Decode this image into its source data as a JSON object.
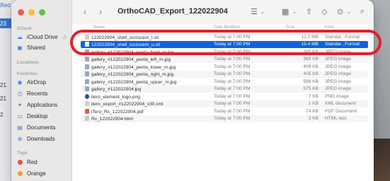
{
  "backdrop": {
    "left_items": [
      "ified",
      "23",
      "21",
      "21",
      "2"
    ]
  },
  "window": {
    "title": "OrthoCAD_Export_122022904",
    "toolbar": {
      "back_icon": "chevron-left",
      "forward_icon": "chevron-right",
      "view_icon": "list-view",
      "group_icon": "grid-view",
      "share_icon": "share",
      "tag_icon": "tag",
      "more_icon": "ellipsis-circle",
      "search_icon": "magnifier"
    },
    "sidebar": {
      "sections": [
        {
          "label": "iCloud",
          "items": [
            {
              "label": "iCloud Drive",
              "icon": "cloud-icon",
              "warning": "⚠"
            },
            {
              "label": "Shared",
              "icon": "shared-folder-icon"
            }
          ]
        },
        {
          "label": "Locations",
          "items": []
        },
        {
          "label": "Favorites",
          "items": [
            {
              "label": "AirDrop",
              "icon": "airdrop-icon"
            },
            {
              "label": "Recents",
              "icon": "clock-icon"
            },
            {
              "label": "Applications",
              "icon": "applications-icon"
            },
            {
              "label": "Desktop",
              "icon": "desktop-icon"
            },
            {
              "label": "Documents",
              "icon": "document-icon"
            },
            {
              "label": "Downloads",
              "icon": "download-icon"
            }
          ]
        },
        {
          "label": "Tags",
          "items": [
            {
              "label": "Red",
              "color": "#ee4b4b"
            },
            {
              "label": "Orange",
              "color": "#f39c34"
            }
          ]
        }
      ]
    },
    "columns": {
      "name": "Name",
      "date": "Date Modified",
      "size": "Size",
      "kind": "Kind"
    },
    "files": [
      {
        "name": "122022904_shell_occlusion_l.stl",
        "date": "Today at 7:00 PM",
        "size": "12.2 MB",
        "kind": "Standar...Format",
        "type": "stl"
      },
      {
        "name": "122022904_shell_occlusion_u.stl",
        "date": "Today at 7:00 PM",
        "size": "15.4 MB",
        "kind": "Standar...Format",
        "type": "stl",
        "selected": true
      },
      {
        "name": "gallery_#122022904_penta_front_m.jpg",
        "date": "Today at 7:00 PM",
        "size": "385 KB",
        "kind": "JPEG image",
        "type": "jpg"
      },
      {
        "name": "gallery_#122022904_penta_left_m.jpg",
        "date": "Today at 7:00 PM",
        "size": "389 KB",
        "kind": "JPEG image",
        "type": "jpg"
      },
      {
        "name": "gallery_#122022904_penta_lower_m.jpg",
        "date": "Today at 7:00 PM",
        "size": "409 KB",
        "kind": "JPEG image",
        "type": "jpg"
      },
      {
        "name": "gallery_#122022904_penta_right_m.jpg",
        "date": "Today at 7:00 PM",
        "size": "405 KB",
        "kind": "JPEG image",
        "type": "jpg"
      },
      {
        "name": "gallery_#122022904_penta_upper_m.jpg",
        "date": "Today at 7:00 PM",
        "size": "596 KB",
        "kind": "JPEG image",
        "type": "jpg"
      },
      {
        "name": "gallery_#122022904.jpg",
        "date": "Today at 7:00 PM",
        "size": "575 KB",
        "kind": "JPEG image",
        "type": "jpg"
      },
      {
        "name": "itero_element_logo.png",
        "date": "Today at 7:00 PM",
        "size": "7 KB",
        "kind": "PNG image",
        "type": "png"
      },
      {
        "name": "itero_export_#122022904_v30.xml",
        "date": "Today at 7:00 PM",
        "size": "1 KB",
        "kind": "XML document",
        "type": "xml"
      },
      {
        "name": "iTero_Rx_122022904.pdf",
        "date": "Today at 7:00 PM",
        "size": "74 KB",
        "kind": "PDF Document",
        "type": "pdf"
      },
      {
        "name": "Rx_122022904.html",
        "date": "Today at 7:00 PM",
        "size": "3 KB",
        "kind": "HTML text",
        "type": "html"
      }
    ]
  },
  "annotation": {
    "color": "#e0202a"
  }
}
